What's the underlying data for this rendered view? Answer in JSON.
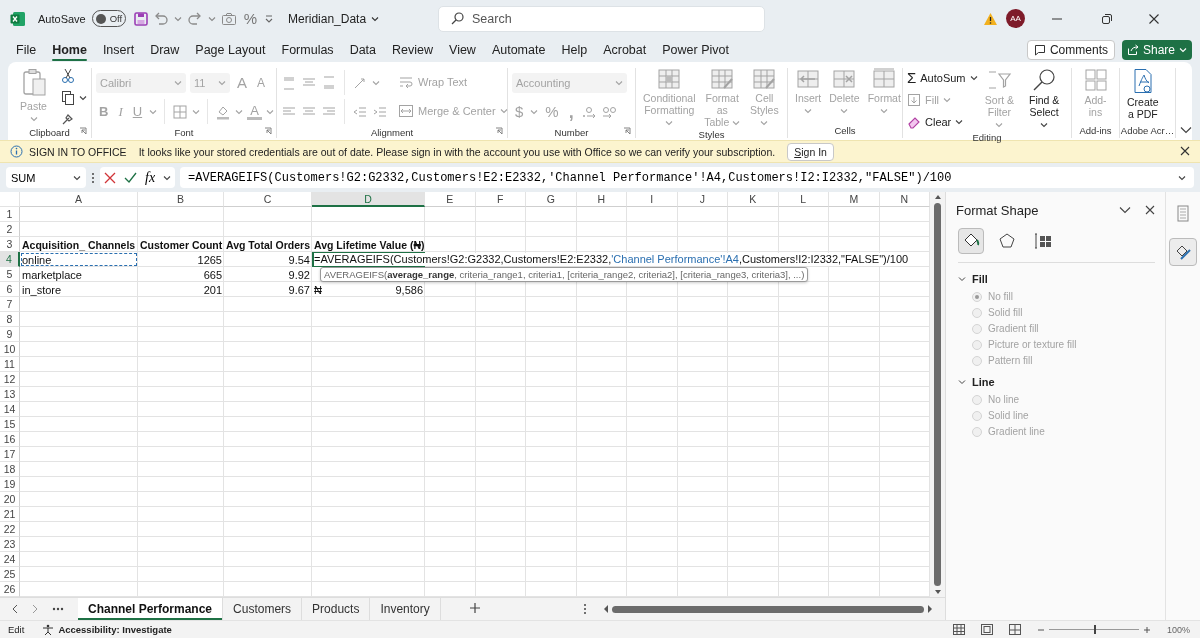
{
  "title_bar": {
    "autosave_label": "AutoSave",
    "autosave_toggle": {
      "label": "Off",
      "on": false
    },
    "quick_access_glyph": "%",
    "file_name": "Meridian_Data",
    "search": {
      "placeholder": "Search"
    },
    "avatar": "AA"
  },
  "menu_tabs": [
    {
      "label": "File",
      "selected": false
    },
    {
      "label": "Home",
      "selected": true
    },
    {
      "label": "Insert",
      "selected": false
    },
    {
      "label": "Draw",
      "selected": false
    },
    {
      "label": "Page Layout",
      "selected": false
    },
    {
      "label": "Formulas",
      "selected": false
    },
    {
      "label": "Data",
      "selected": false
    },
    {
      "label": "Review",
      "selected": false
    },
    {
      "label": "View",
      "selected": false
    },
    {
      "label": "Automate",
      "selected": false
    },
    {
      "label": "Help",
      "selected": false
    },
    {
      "label": "Acrobat",
      "selected": false
    },
    {
      "label": "Power Pivot",
      "selected": false
    }
  ],
  "header_buttons": {
    "comments": "Comments",
    "share": "Share"
  },
  "ribbon": {
    "groups": [
      {
        "label": "Clipboard",
        "items": [
          {
            "kind": "large",
            "label": "Paste",
            "disabled": true
          }
        ]
      },
      {
        "label": "Font",
        "items": [
          {
            "kind": "dropdown",
            "value": "Calibri",
            "disabled": true
          },
          {
            "kind": "dropdown",
            "value": "11",
            "disabled": true
          },
          {
            "kind": "glyph",
            "text": "A",
            "disabled": true
          },
          {
            "kind": "glyph",
            "text": "A",
            "disabled": true
          },
          {
            "kind": "glyph",
            "text": "B",
            "disabled": true
          },
          {
            "kind": "glyph",
            "text": "I",
            "disabled": true
          },
          {
            "kind": "glyph",
            "text": "U",
            "disabled": true
          },
          {
            "kind": "glyph",
            "text": "A",
            "disabled": true
          }
        ]
      },
      {
        "label": "Alignment",
        "items": [
          {
            "kind": "small",
            "label": "Wrap Text",
            "disabled": true
          },
          {
            "kind": "small",
            "label": "Merge & Center",
            "disabled": true
          }
        ]
      },
      {
        "label": "Number",
        "items": [
          {
            "kind": "dropdown",
            "value": "Accounting",
            "disabled": true
          },
          {
            "kind": "glyph",
            "text": "$",
            "disabled": true
          },
          {
            "kind": "glyph",
            "text": "%",
            "disabled": true
          },
          {
            "kind": "glyph",
            "text": ",",
            "disabled": true
          }
        ]
      },
      {
        "label": "Styles",
        "items": [
          {
            "kind": "large",
            "label": "Conditional\nFormatting",
            "disabled": true
          },
          {
            "kind": "large",
            "label": "Format as\nTable",
            "disabled": true
          },
          {
            "kind": "large",
            "label": "Cell\nStyles",
            "disabled": true
          }
        ]
      },
      {
        "label": "Cells",
        "items": [
          {
            "kind": "large",
            "label": "Insert",
            "disabled": true
          },
          {
            "kind": "large",
            "label": "Delete",
            "disabled": true
          },
          {
            "kind": "large",
            "label": "Format",
            "disabled": true
          }
        ]
      },
      {
        "label": "Editing",
        "items": [
          {
            "kind": "small",
            "symbol": "Σ",
            "label": "AutoSum",
            "disabled": false
          },
          {
            "kind": "small",
            "label": "Fill",
            "disabled": true
          },
          {
            "kind": "small",
            "label": "Clear",
            "disabled": false
          },
          {
            "kind": "large",
            "label": "Sort &\nFilter",
            "disabled": true
          },
          {
            "kind": "large",
            "label": "Find &\nSelect",
            "disabled": false
          }
        ]
      },
      {
        "label": "Add-ins",
        "items": [
          {
            "kind": "large",
            "label": "Add-ins",
            "disabled": true
          }
        ]
      },
      {
        "label": "Adobe Acr…",
        "items": [
          {
            "kind": "large",
            "label": "Create\na PDF",
            "disabled": false
          }
        ]
      }
    ]
  },
  "message_bar": {
    "title": "SIGN IN TO OFFICE",
    "text": "It looks like your stored credentials are out of date. Please sign in with the account you use with Office so we can verify your subscription.",
    "button": "Sign In"
  },
  "formula_bar": {
    "name_box": "SUM",
    "fx": "fx",
    "formula": "=AVERAGEIFS(Customers!G2:G2332,Customers!E2:E2332,'Channel Performance'!A4,Customers!I2:I2332,\"FALSE\")/100"
  },
  "sheet": {
    "columns": [
      {
        "label": "A",
        "selected": false
      },
      {
        "label": "B",
        "selected": false
      },
      {
        "label": "C",
        "selected": false
      },
      {
        "label": "D",
        "selected": true
      },
      {
        "label": "E",
        "selected": false
      },
      {
        "label": "F",
        "selected": false
      },
      {
        "label": "G",
        "selected": false
      },
      {
        "label": "H",
        "selected": false
      },
      {
        "label": "I",
        "selected": false
      },
      {
        "label": "J",
        "selected": false
      },
      {
        "label": "K",
        "selected": false
      },
      {
        "label": "L",
        "selected": false
      },
      {
        "label": "M",
        "selected": false
      },
      {
        "label": "N",
        "selected": false
      }
    ],
    "rows": [
      {
        "number": "1",
        "selected": false
      },
      {
        "number": "2",
        "selected": false
      },
      {
        "number": "3",
        "selected": false,
        "cells": [
          {
            "kind": "header",
            "text": "Acquisition_ Channels",
            "referenced": false
          },
          {
            "kind": "header",
            "text": "Customer Count",
            "referenced": false
          },
          {
            "kind": "header",
            "text": "Avg Total Orders",
            "referenced": false
          },
          {
            "kind": "header",
            "text": "Avg Lifetime Value (₦)",
            "referenced": false
          }
        ]
      },
      {
        "number": "4",
        "selected": true,
        "cells": [
          {
            "kind": "text",
            "text": "online",
            "referenced": true
          },
          {
            "kind": "number",
            "text": "1265",
            "referenced": false
          },
          {
            "kind": "number",
            "text": "9.54",
            "referenced": false
          },
          {
            "kind": "editor",
            "referenced": false,
            "segments": [
              {
                "text": "=AVERAGEIFS(Customers!G2:G2332,Customers!E2:E2332,",
                "reference": false
              },
              {
                "text": "'Channel Performance'!A4",
                "reference": true
              },
              {
                "text": ",Customers!I2:I2332,\"FALSE\")/100",
                "reference": false
              }
            ]
          }
        ]
      },
      {
        "number": "5",
        "selected": false,
        "cells": [
          {
            "kind": "text",
            "text": "marketplace",
            "referenced": false
          },
          {
            "kind": "number",
            "text": "665",
            "referenced": false
          },
          {
            "kind": "number",
            "text": "9.92",
            "referenced": false
          },
          {
            "kind": "tooltip",
            "referenced": false,
            "text": "AVERAGEIFS(**average_range**, criteria_range1, criteria1, [criteria_range2, criteria2], [criteria_range3, criteria3], ...)"
          }
        ]
      },
      {
        "number": "6",
        "selected": false,
        "cells": [
          {
            "kind": "text",
            "text": "in_store",
            "referenced": false
          },
          {
            "kind": "number",
            "text": "201",
            "referenced": false
          },
          {
            "kind": "number",
            "text": "9.67",
            "referenced": false
          },
          {
            "kind": "accounting",
            "symbol": "₦",
            "text": "9,586",
            "referenced": false
          }
        ]
      },
      {
        "number": "7",
        "selected": false
      },
      {
        "number": "8",
        "selected": false
      },
      {
        "number": "9",
        "selected": false
      },
      {
        "number": "10",
        "selected": false
      },
      {
        "number": "11",
        "selected": false
      },
      {
        "number": "12",
        "selected": false
      },
      {
        "number": "13",
        "selected": false
      },
      {
        "number": "14",
        "selected": false
      },
      {
        "number": "15",
        "selected": false
      },
      {
        "number": "16",
        "selected": false
      },
      {
        "number": "17",
        "selected": false
      },
      {
        "number": "18",
        "selected": false
      },
      {
        "number": "19",
        "selected": false
      },
      {
        "number": "20",
        "selected": false
      },
      {
        "number": "21",
        "selected": false
      },
      {
        "number": "22",
        "selected": false
      },
      {
        "number": "23",
        "selected": false
      },
      {
        "number": "24",
        "selected": false
      },
      {
        "number": "25",
        "selected": false
      },
      {
        "number": "26",
        "selected": false
      }
    ]
  },
  "sheet_tabs": [
    {
      "label": "Channel Performance",
      "selected": true
    },
    {
      "label": "Customers",
      "selected": false
    },
    {
      "label": "Products",
      "selected": false
    },
    {
      "label": "Inventory",
      "selected": false
    }
  ],
  "format_pane": {
    "title": "Format Shape",
    "tabs": [
      {
        "selected": true
      },
      {
        "selected": false
      },
      {
        "selected": false
      }
    ],
    "sections": [
      {
        "title": "Fill",
        "expanded": true,
        "options": [
          {
            "label": "No fill",
            "selected": true,
            "disabled": true
          },
          {
            "label": "Solid fill",
            "selected": false,
            "disabled": true
          },
          {
            "label": "Gradient fill",
            "selected": false,
            "disabled": true
          },
          {
            "label": "Picture or texture fill",
            "selected": false,
            "disabled": true
          },
          {
            "label": "Pattern fill",
            "selected": false,
            "disabled": true
          }
        ]
      },
      {
        "title": "Line",
        "expanded": true,
        "options": [
          {
            "label": "No line",
            "selected": false,
            "disabled": true
          },
          {
            "label": "Solid line",
            "selected": false,
            "disabled": true
          },
          {
            "label": "Gradient line",
            "selected": false,
            "disabled": true
          }
        ]
      }
    ],
    "side_buttons": [
      {
        "selected": false
      },
      {
        "selected": true
      }
    ]
  },
  "status_bar": {
    "mode": "Edit",
    "accessibility": "Accessibility: Investigate",
    "zoom": {
      "level": 0.5,
      "label": "100%"
    }
  }
}
